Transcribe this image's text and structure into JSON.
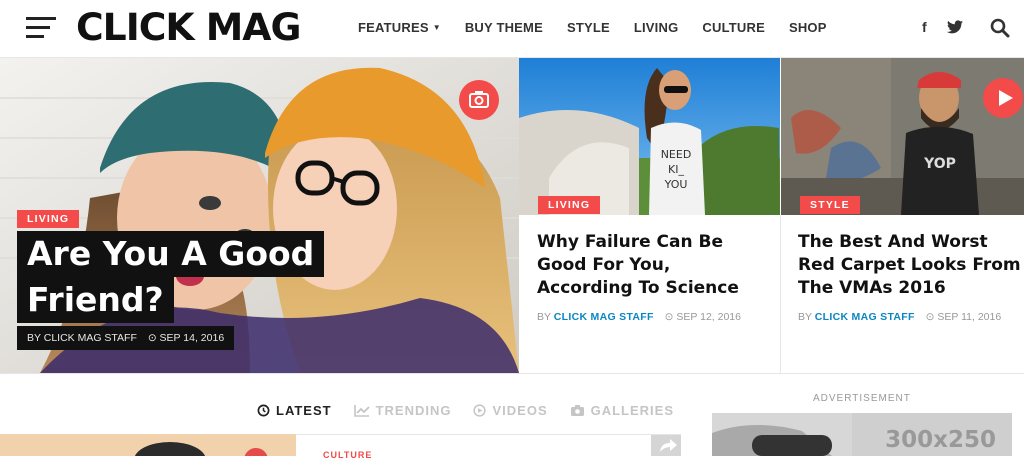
{
  "site": {
    "logo": "CLICK MAG"
  },
  "nav": {
    "items": [
      {
        "label": "FEATURES",
        "has_dropdown": true
      },
      {
        "label": "BUY THEME"
      },
      {
        "label": "STYLE"
      },
      {
        "label": "LIVING"
      },
      {
        "label": "CULTURE"
      },
      {
        "label": "SHOP"
      }
    ],
    "social": {
      "facebook": "f",
      "twitter": "twitter-icon"
    },
    "search_icon": "search-icon"
  },
  "hero": {
    "category": "LIVING",
    "title_line1": "Are You A Good",
    "title_line2": "Friend?",
    "meta": "BY CLICK MAG STAFF",
    "date": "SEP 14, 2016",
    "badge_icon": "camera-icon"
  },
  "cards": [
    {
      "category": "LIVING",
      "title": "Why Failure Can Be Good For You, According To Science",
      "by": "BY",
      "author": "CLICK MAG STAFF",
      "date": "SEP 12, 2016"
    },
    {
      "category": "STYLE",
      "title": "The Best And Worst Red Carpet Looks From The VMAs 2016",
      "by": "BY",
      "author": "CLICK MAG STAFF",
      "date": "SEP 11, 2016",
      "badge_icon": "play-icon"
    }
  ],
  "tabs": [
    {
      "label": "LATEST",
      "icon": "clock-icon",
      "active": true
    },
    {
      "label": "TRENDING",
      "icon": "trending-icon"
    },
    {
      "label": "VIDEOS",
      "icon": "play-circle-icon"
    },
    {
      "label": "GALLERIES",
      "icon": "camera-icon"
    }
  ],
  "sidebar": {
    "ad_label": "ADVERTISEMENT",
    "ad_size": "300x250"
  },
  "list": {
    "category": "CULTURE"
  },
  "colors": {
    "accent": "#f34a4a",
    "link": "#0b86c3",
    "text": "#222222"
  }
}
